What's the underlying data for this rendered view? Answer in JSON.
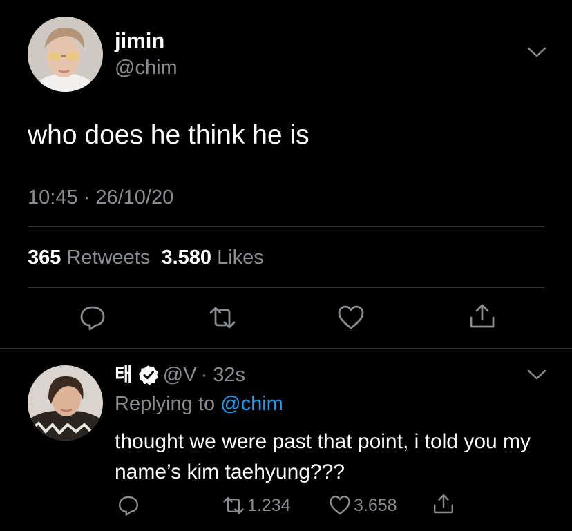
{
  "main_tweet": {
    "name": "jimin",
    "handle": "@chim",
    "text": "who does he think he is",
    "timestamp": "10:45 · 26/10/20",
    "retweets_count": "365",
    "retweets_label": "Retweets",
    "likes_count": "3.580",
    "likes_label": "Likes"
  },
  "reply": {
    "name": "태",
    "handle": "@V",
    "time": "· 32s",
    "replying_prefix": "Replying to",
    "replying_mention": "@chim",
    "text": "thought we were past that point, i told you my name’s kim taehyung???",
    "retweets": "1.234",
    "likes": "3.658"
  },
  "colors": {
    "background": "#000000",
    "text": "#ffffff",
    "secondary": "#8a8d91",
    "accent": "#1d9bf0",
    "divider": "#2f3336"
  },
  "icons": {
    "chevron": "chevron-down-icon",
    "reply": "reply-icon",
    "retweet": "retweet-icon",
    "like": "heart-icon",
    "share": "share-icon",
    "verified": "verified-badge-icon"
  }
}
